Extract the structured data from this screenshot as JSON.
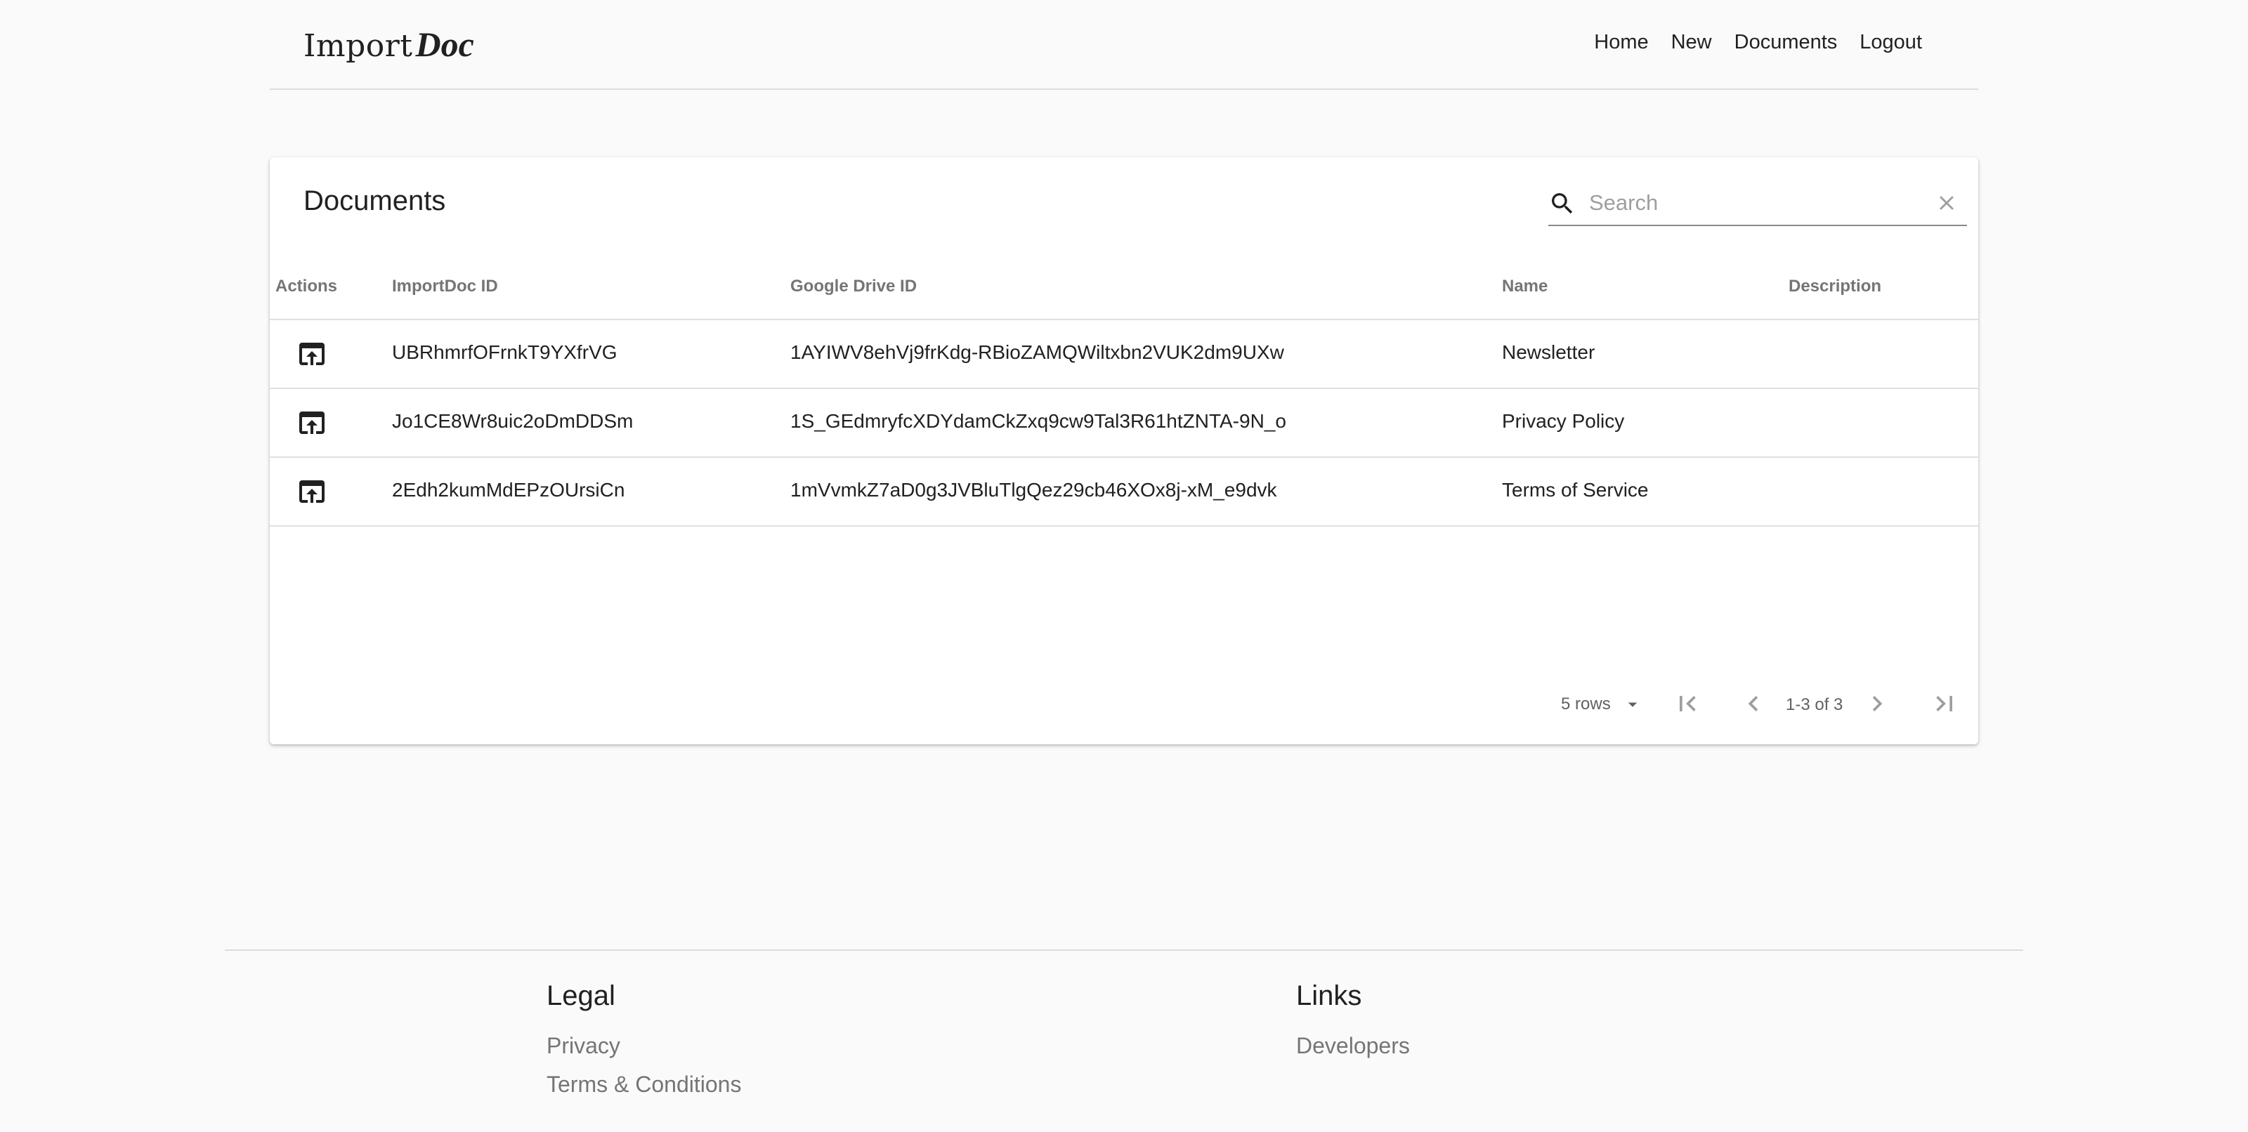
{
  "brand": {
    "logo_text_a": "Import",
    "logo_text_b": "Doc"
  },
  "nav": {
    "items": [
      {
        "label": "Home"
      },
      {
        "label": "New"
      },
      {
        "label": "Documents"
      },
      {
        "label": "Logout"
      }
    ]
  },
  "card": {
    "title": "Documents",
    "search": {
      "placeholder": "Search",
      "value": ""
    }
  },
  "table": {
    "columns": [
      "Actions",
      "ImportDoc ID",
      "Google Drive ID",
      "Name",
      "Description"
    ],
    "rows": [
      {
        "action_icon": "open-in-browser-icon",
        "importdoc_id": "UBRhmrfOFrnkT9YXfrVG",
        "drive_id": "1AYIWV8ehVj9frKdg-RBioZAMQWiltxbn2VUK2dm9UXw",
        "name": "Newsletter",
        "description": ""
      },
      {
        "action_icon": "open-in-browser-icon",
        "importdoc_id": "Jo1CE8Wr8uic2oDmDDSm",
        "drive_id": "1S_GEdmryfcXDYdamCkZxq9cw9Tal3R61htZNTA-9N_o",
        "name": "Privacy Policy",
        "description": ""
      },
      {
        "action_icon": "open-in-browser-icon",
        "importdoc_id": "2Edh2kumMdEPzOUrsiCn",
        "drive_id": "1mVvmkZ7aD0g3JVBluTlgQez29cb46XOx8j-xM_e9dvk",
        "name": "Terms of Service",
        "description": ""
      }
    ]
  },
  "pagination": {
    "rows_per_page": "5 rows",
    "range_label": "1-3 of 3"
  },
  "footer": {
    "legal": {
      "heading": "Legal",
      "links": [
        "Privacy",
        "Terms & Conditions"
      ]
    },
    "links": {
      "heading": "Links",
      "links": [
        "Developers"
      ]
    }
  },
  "colors": {
    "background": "#fafafa",
    "card": "#ffffff",
    "text": "#212121",
    "muted": "#757575",
    "divider": "#e0e0e0"
  }
}
